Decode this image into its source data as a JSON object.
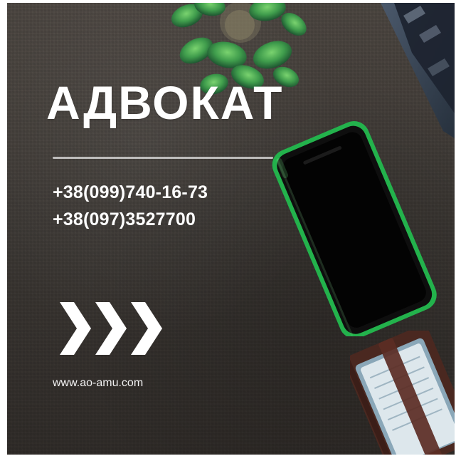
{
  "brand": {
    "title": "АДВОКАТ"
  },
  "contacts": {
    "phone_1": "+38(099)740-16-73",
    "phone_2": "+38(097)3527700"
  },
  "website": {
    "label": "www.ao-amu.com"
  },
  "decor": {
    "arrows_icon": "triple-chevron-right-icon",
    "background_color": "#3f3a36",
    "phone_accent": "#2db34a",
    "notebook_cover": "#4a2820"
  }
}
